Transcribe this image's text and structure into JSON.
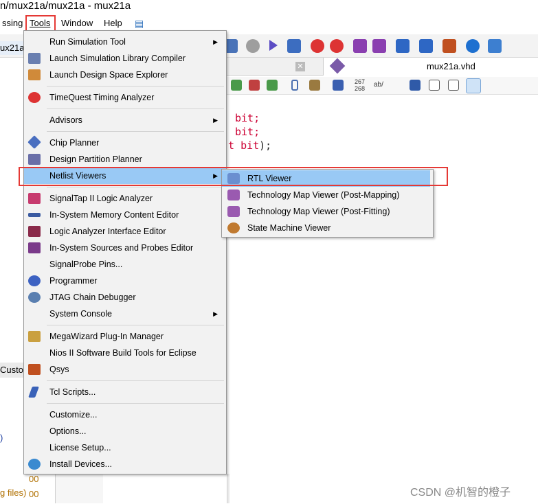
{
  "window": {
    "title": "n/mux21a/mux21a - mux21a"
  },
  "menubar": {
    "partial": "ssing",
    "tools": "Tools",
    "window": "Window",
    "help": "Help"
  },
  "left_fragments": {
    "project_tab": "ux21a",
    "custom_tab": "Custom",
    "paren": ")",
    "files": "g files)",
    "num1": "00",
    "num2": "00"
  },
  "editor": {
    "tab_title": "mux21a.vhd",
    "code_line1": "bit;",
    "code_line2": "bit;",
    "code_line3_a": "t",
    "code_line3_b": "bit",
    "code_line3_c": ");",
    "line_num_top": "267",
    "line_num_bottom": "268",
    "ab_label": "ab/"
  },
  "tools_menu": {
    "items": [
      {
        "label": "Run Simulation Tool",
        "icon": "none",
        "submenu": true
      },
      {
        "label": "Launch Simulation Library Compiler",
        "icon": "compiler-icon"
      },
      {
        "label": "Launch Design Space Explorer",
        "icon": "dse-icon"
      },
      {
        "label": "TimeQuest Timing Analyzer",
        "icon": "stopwatch-icon"
      },
      {
        "label": "Advisors",
        "icon": "none",
        "submenu": true
      },
      {
        "label": "Chip Planner",
        "icon": "chip-planner-icon"
      },
      {
        "label": "Design Partition Planner",
        "icon": "partition-icon"
      },
      {
        "label": "Netlist Viewers",
        "icon": "none",
        "submenu": true
      },
      {
        "label": "SignalTap II Logic Analyzer",
        "icon": "signaltap-icon"
      },
      {
        "label": "In-System Memory Content Editor",
        "icon": "memory-icon"
      },
      {
        "label": "Logic Analyzer Interface Editor",
        "icon": "lai-icon"
      },
      {
        "label": "In-System Sources and Probes Editor",
        "icon": "probes-icon"
      },
      {
        "label": "SignalProbe Pins...",
        "icon": "none"
      },
      {
        "label": "Programmer",
        "icon": "programmer-icon"
      },
      {
        "label": "JTAG Chain Debugger",
        "icon": "jtag-icon"
      },
      {
        "label": "System Console",
        "icon": "none",
        "submenu": true
      },
      {
        "label": "MegaWizard Plug-In Manager",
        "icon": "wand-icon"
      },
      {
        "label": "Nios II Software Build Tools for Eclipse",
        "icon": "none"
      },
      {
        "label": "Qsys",
        "icon": "qsys-icon"
      },
      {
        "label": "Tcl Scripts...",
        "icon": "feather-icon"
      },
      {
        "label": "Customize...",
        "icon": "none"
      },
      {
        "label": "Options...",
        "icon": "none"
      },
      {
        "label": "License Setup...",
        "icon": "none"
      },
      {
        "label": "Install Devices...",
        "icon": "install-icon"
      }
    ]
  },
  "netlist_submenu": {
    "items": [
      {
        "label": "RTL Viewer",
        "icon": "rtl-viewer-icon"
      },
      {
        "label": "Technology Map Viewer (Post-Mapping)",
        "icon": "tech-map-icon"
      },
      {
        "label": "Technology Map Viewer (Post-Fitting)",
        "icon": "tech-map-fit-icon"
      },
      {
        "label": "State Machine Viewer",
        "icon": "state-machine-icon"
      }
    ]
  },
  "watermark": "CSDN @机智的橙子",
  "colors": {
    "highlight": "#99c9f5",
    "annotation_red": "#e53935",
    "keyword": "#cc0033"
  }
}
